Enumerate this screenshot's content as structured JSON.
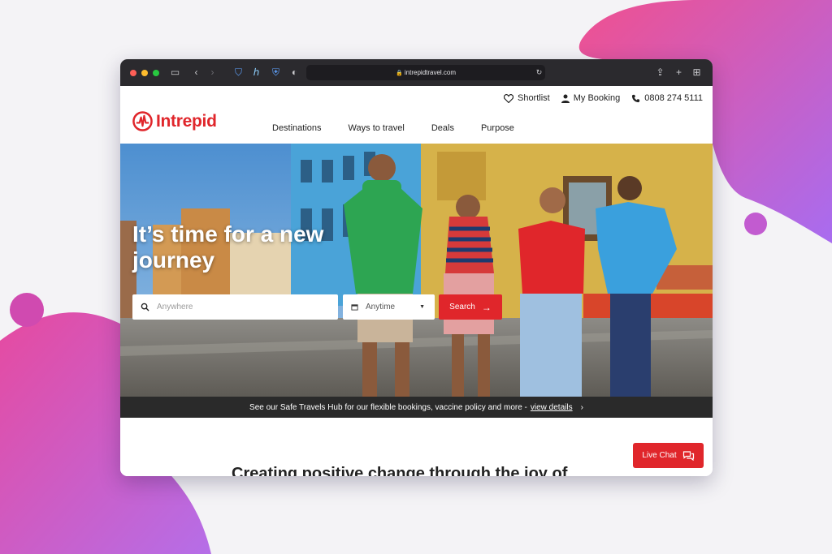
{
  "browser": {
    "url": "intrepidtravel.com"
  },
  "site": {
    "logo_text": "Intrepid",
    "topbar": {
      "shortlist": "Shortlist",
      "my_booking": "My Booking",
      "phone": "0808 274 5111"
    },
    "nav": [
      "Destinations",
      "Ways to travel",
      "Deals",
      "Purpose"
    ],
    "hero": {
      "title": "It’s time for a new journey",
      "search_placeholder": "Anywhere",
      "date_value": "Anytime",
      "search_button": "Search"
    },
    "banner": {
      "text": "See our Safe Travels Hub for our flexible bookings, vaccine policy and more -",
      "link": "view details"
    },
    "section_heading": "Creating positive change through the joy of",
    "live_chat": "Live Chat"
  },
  "colors": {
    "brand_red": "#e0262b",
    "bg_gradient_pink": "#e94b9a",
    "bg_gradient_purple": "#9b6cf0"
  }
}
